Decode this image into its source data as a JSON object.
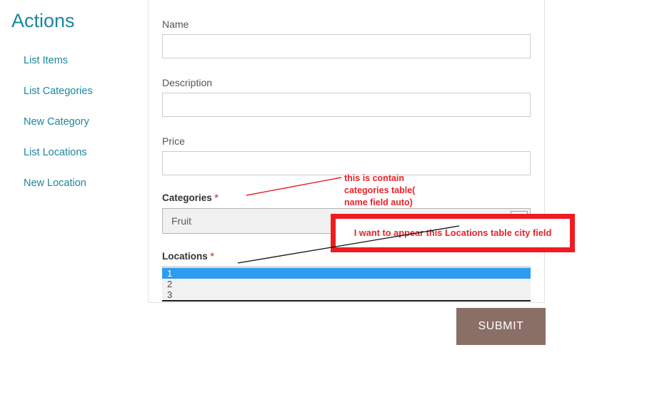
{
  "sidebar": {
    "title": "Actions",
    "items": [
      {
        "label": "List Items"
      },
      {
        "label": "List Categories"
      },
      {
        "label": "New Category"
      },
      {
        "label": "List Locations"
      },
      {
        "label": "New Location"
      }
    ]
  },
  "form": {
    "name": {
      "label": "Name",
      "value": "",
      "placeholder": ""
    },
    "description": {
      "label": "Description",
      "value": "",
      "placeholder": ""
    },
    "price": {
      "label": "Price",
      "value": "",
      "placeholder": ""
    },
    "categories": {
      "label": "Categories",
      "required_marker": "*",
      "selected": "Fruit",
      "options": [
        "Fruit"
      ]
    },
    "locations": {
      "label": "Locations",
      "required_marker": "*",
      "selected": "1",
      "options": [
        "1",
        "2",
        "3"
      ]
    },
    "submit_label": "SUBMIT"
  },
  "annotations": {
    "categories_note_line1": "this is contain",
    "categories_note_line2": "categories table(",
    "categories_note_line3": "name field auto)",
    "locations_note": "I want to appear this Locations table city field"
  },
  "colors": {
    "accent_teal": "#1b879e",
    "annotation_red": "#e8232a",
    "box_border_red": "#ee1c21",
    "submit_brown": "#8a6f66",
    "option_highlight_blue": "#2d9bf0",
    "required_star": "#d9534f"
  }
}
